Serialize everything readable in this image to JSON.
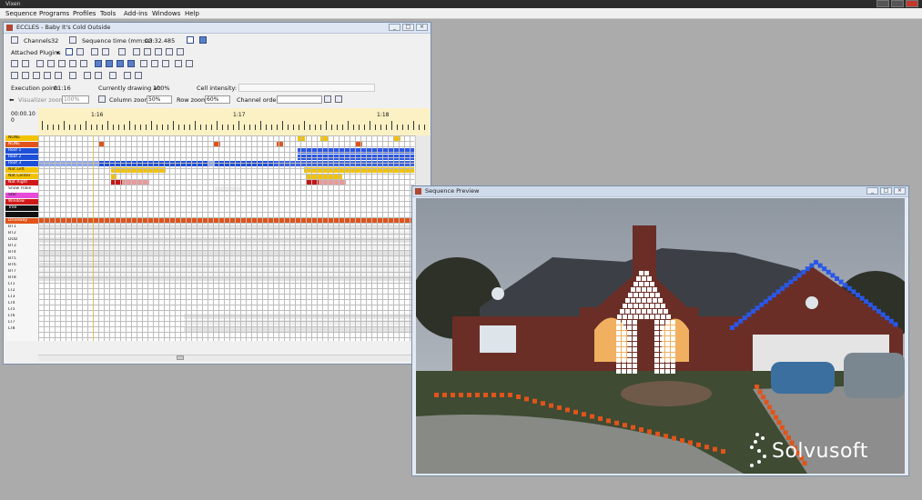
{
  "app": {
    "title": "Vixen",
    "menu": [
      "Sequence",
      "Programs",
      "Profiles",
      "Tools",
      "Add-ins",
      "Windows",
      "Help"
    ]
  },
  "sequence_window": {
    "title": "ECCLES - Baby It's Cold Outside",
    "channels_label": "Channels",
    "channels_value": "32",
    "seq_time_label": "Sequence time (mm:ss)",
    "seq_time_value": "03:32.485",
    "attached_plugins_label": "Attached Plugins",
    "execution_point_label": "Execution point:",
    "execution_point_value": "01:16",
    "drawing_at_label": "Currently drawing at:",
    "drawing_at_value": "100%",
    "cell_intensity_label": "Cell intensity:",
    "visualizer_zoom_label": "Visualizer zoom",
    "visualizer_zoom_value": "100%",
    "column_zoom_label": "Column zoom",
    "column_zoom_value": "50%",
    "row_zoom_label": "Row zoom",
    "row_zoom_value": "60%",
    "channel_order_label": "Channel order",
    "time_readout_top": "00:00.10",
    "time_readout_bottom": "0",
    "timeline_marks": [
      "1:16",
      "1:17",
      "1:18"
    ],
    "channels": [
      {
        "name": "NONE",
        "color": "#f2c300"
      },
      {
        "name": "NONE",
        "color": "#e0541b"
      },
      {
        "name": "Roof 1",
        "color": "#1d4fd8"
      },
      {
        "name": "Roof 2",
        "color": "#1d4fd8"
      },
      {
        "name": "Roof 3",
        "color": "#1d4fd8"
      },
      {
        "name": "Nat Left",
        "color": "#f2c300"
      },
      {
        "name": "Nat Center",
        "color": "#f2c300"
      },
      {
        "name": "Nat Right",
        "color": "#d01818"
      },
      {
        "name": "Snow Flake",
        "color": "#ffffff"
      },
      {
        "name": "Star",
        "color": "#e74ad8"
      },
      {
        "name": "Window",
        "color": "#d01818"
      },
      {
        "name": "Tree",
        "color": "#111111"
      },
      {
        "name": "",
        "color": "#111111"
      },
      {
        "name": "Driveway",
        "color": "#e0541b"
      },
      {
        "name": "BT1",
        "color": "#f6f6f6"
      },
      {
        "name": "BT2",
        "color": "#f6f6f6"
      },
      {
        "name": "DUD",
        "color": "#f6f6f6"
      },
      {
        "name": "BT3",
        "color": "#f6f6f6"
      },
      {
        "name": "BT4",
        "color": "#f6f6f6"
      },
      {
        "name": "BT5",
        "color": "#f6f6f6"
      },
      {
        "name": "BT6",
        "color": "#f6f6f6"
      },
      {
        "name": "BT7",
        "color": "#f6f6f6"
      },
      {
        "name": "BT8",
        "color": "#f6f6f6"
      },
      {
        "name": "LT1",
        "color": "#f6f6f6"
      },
      {
        "name": "LT2",
        "color": "#f6f6f6"
      },
      {
        "name": "LT3",
        "color": "#f6f6f6"
      },
      {
        "name": "LT4",
        "color": "#f6f6f6"
      },
      {
        "name": "LT5",
        "color": "#f6f6f6"
      },
      {
        "name": "LT6",
        "color": "#f6f6f6"
      },
      {
        "name": "LT7",
        "color": "#f6f6f6"
      },
      {
        "name": "LT8",
        "color": "#f6f6f6"
      }
    ]
  },
  "preview_window": {
    "title": "Sequence Preview"
  },
  "watermark": {
    "text": "Solvusoft"
  },
  "colors": {
    "roof_lights": "#2a57e8",
    "driveway_lights": "#e0541b",
    "arch_lights": "#ffffff"
  }
}
